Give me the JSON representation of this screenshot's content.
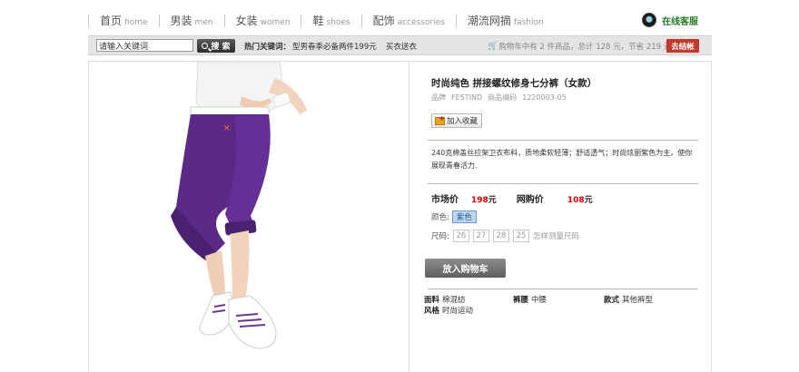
{
  "nav": {
    "items": [
      {
        "zh": "首页",
        "en": "home"
      },
      {
        "zh": "男装",
        "en": "men"
      },
      {
        "zh": "女装",
        "en": "women"
      },
      {
        "zh": "鞋",
        "en": "shoes"
      },
      {
        "zh": "配饰",
        "en": "accessories"
      },
      {
        "zh": "潮流网摘",
        "en": "fashion"
      }
    ],
    "service_label": "在线客服"
  },
  "search": {
    "value": "请输入关键词",
    "button_label": "搜 索",
    "hot_label": "热门关键词：",
    "hot_links": [
      "型男春季必备两件199元",
      "买衣送衣"
    ]
  },
  "cart": {
    "text": "购物车中有 2 件商品，总计 128 元，节省 219 元",
    "checkout_label": "去结帐"
  },
  "product": {
    "image_alt": "purple cropped pants product photo",
    "title": "时尚纯色 拼接螺纹修身七分裤（女款）",
    "brand_label": "品牌",
    "brand": "FESTIND",
    "code_label": "商品编码",
    "code": "1220003-05",
    "favorite_label": "加入收藏",
    "description": "240克棉盖丝拉架卫衣布料，质地柔软轻薄；舒适透气；时尚炫丽紫色为主，使你展现青春活力.",
    "market_price_label": "市场价",
    "market_price": "198",
    "online_price_label": "网购价",
    "online_price": "108",
    "currency": "元",
    "color_label": "颜色:",
    "color_value": "紫色",
    "size_label": "尺码:",
    "sizes": [
      "26",
      "27",
      "28",
      "25"
    ],
    "size_guide": "怎样测量尺码",
    "add_to_cart_label": "放入购物车",
    "attributes": [
      {
        "key": "面料",
        "value": "棉混纺"
      },
      {
        "key": "裤腰",
        "value": "中腰"
      },
      {
        "key": "款式",
        "value": "其他裤型"
      },
      {
        "key": "风格",
        "value": "时尚运动"
      }
    ]
  },
  "colors": {
    "accent_red": "#c0392b",
    "price_red": "#d20000",
    "pants_purple": "#5b2a86",
    "service_green": "#2a7a2a"
  }
}
